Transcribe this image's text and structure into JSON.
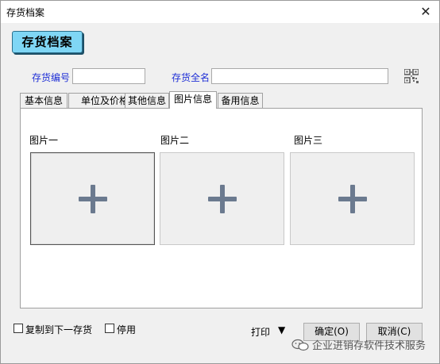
{
  "window": {
    "title": "存货档案",
    "close_glyph": "✕"
  },
  "banner": {
    "text": "存货档案"
  },
  "fields": {
    "code_label": "存货编号",
    "code_value": "",
    "fullname_label": "存货全名",
    "fullname_value": "",
    "qr_icon": "qr-code-icon"
  },
  "tabs": [
    {
      "label": "基本信息",
      "active": false
    },
    {
      "label": "单位及价格",
      "active": false
    },
    {
      "label": "其他信息",
      "active": false
    },
    {
      "label": "图片信息",
      "active": true
    },
    {
      "label": "备用信息",
      "active": false
    }
  ],
  "pictures": [
    {
      "label": "图片一",
      "selected": true
    },
    {
      "label": "图片二",
      "selected": false
    },
    {
      "label": "图片三",
      "selected": false
    }
  ],
  "footer": {
    "copy_next_label": "复制到下一存货",
    "copy_next_checked": false,
    "disable_label": "停用",
    "disable_checked": false,
    "print_label": "打印",
    "print_arrow": "▼",
    "ok_label": "确定(O)",
    "cancel_label": "取消(C)"
  },
  "watermark": {
    "text": "企业进销存软件技术服务"
  },
  "colors": {
    "banner_bg": "#7fd6f5",
    "label_blue": "#1f2fd6",
    "plus_gray": "#6b7a8f"
  }
}
